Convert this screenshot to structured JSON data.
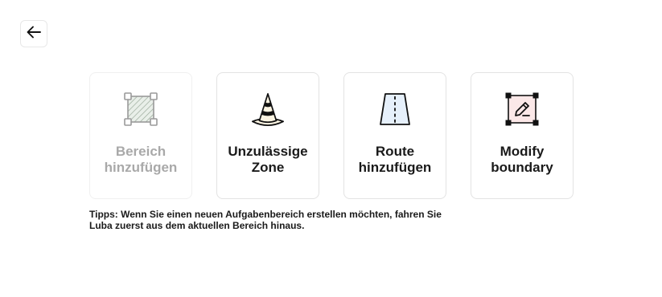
{
  "back_button": {
    "icon": "arrow-left-icon"
  },
  "cards": [
    {
      "label_line1": "Bereich",
      "label_line2": "hinzufügen",
      "icon": "area-polygon-icon",
      "disabled": true
    },
    {
      "label_line1": "Unzulässige",
      "label_line2": "Zone",
      "icon": "traffic-cone-icon",
      "disabled": false
    },
    {
      "label_line1": "Route",
      "label_line2": "hinzufügen",
      "icon": "route-road-icon",
      "disabled": false
    },
    {
      "label_line1": "Modify",
      "label_line2": "boundary",
      "icon": "edit-boundary-icon",
      "disabled": false
    }
  ],
  "tips": "Tipps: Wenn Sie einen neuen Aufgabenbereich erstellen möchten, fahren Sie Luba zuerst aus dem aktuellen Bereich hinaus.",
  "colors": {
    "text": "#1a1a1a",
    "disabled_text": "#a9a9a9",
    "card_border": "#e3e3e3",
    "route_fill": "#e6f0fb",
    "boundary_fill": "#fbe8e8",
    "cone_fill": "#fbf4e2"
  }
}
